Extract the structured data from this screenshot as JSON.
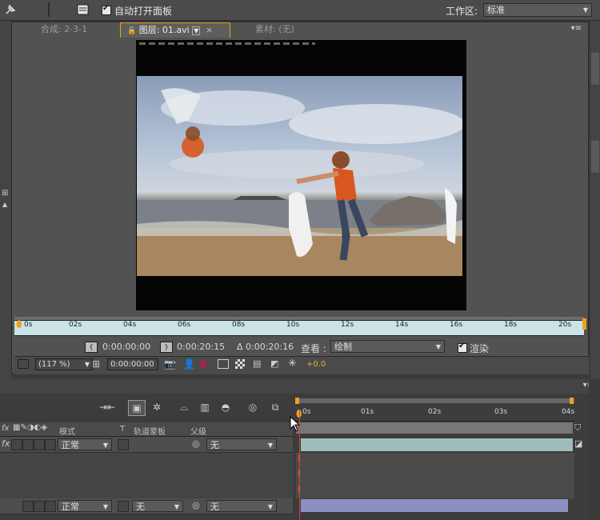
{
  "toolbar": {
    "auto_open_panels_label": "自动打开面板",
    "auto_open_panels_checked": true,
    "workspace_label": "工作区:",
    "workspace_value": "标准"
  },
  "viewer": {
    "tabs": [
      {
        "label": "合成: 2-3-1",
        "active": false
      },
      {
        "label": "图层: 01.avi",
        "active": true
      },
      {
        "label": "素材: (无)",
        "active": false
      }
    ],
    "ruler_ticks": [
      "0s",
      "02s",
      "04s",
      "06s",
      "08s",
      "10s",
      "12s",
      "14s",
      "16s",
      "18s",
      "20s"
    ],
    "in_time": "0:00:00:00",
    "out_time": "0:00:20:15",
    "duration": "Δ 0:00:20:16",
    "view_label": "查看 :",
    "view_value": "绘制",
    "render_label": "渲染",
    "render_checked": true,
    "zoom_value": "(117 %)",
    "current_time": "0:00:00:00",
    "exposure": "+0.0"
  },
  "timeline": {
    "ruler_ticks": [
      "0s",
      "01s",
      "02s",
      "03s",
      "04s"
    ],
    "columns": {
      "mode": "模式",
      "t": "T",
      "track_matte": "轨道蒙板",
      "parent": "父级"
    },
    "rows": [
      {
        "mode": "正常",
        "track_matte": "",
        "parent": "无"
      },
      {
        "mode": "正常",
        "track_matte": "无",
        "parent": "无"
      }
    ]
  },
  "colors": {
    "accent": "#f0a020",
    "playhead": "#d84030",
    "ruler_bg": "#c9e3e6",
    "layer_bar_1": "#9fbcbc",
    "layer_bar_2": "#8c8fc0"
  }
}
